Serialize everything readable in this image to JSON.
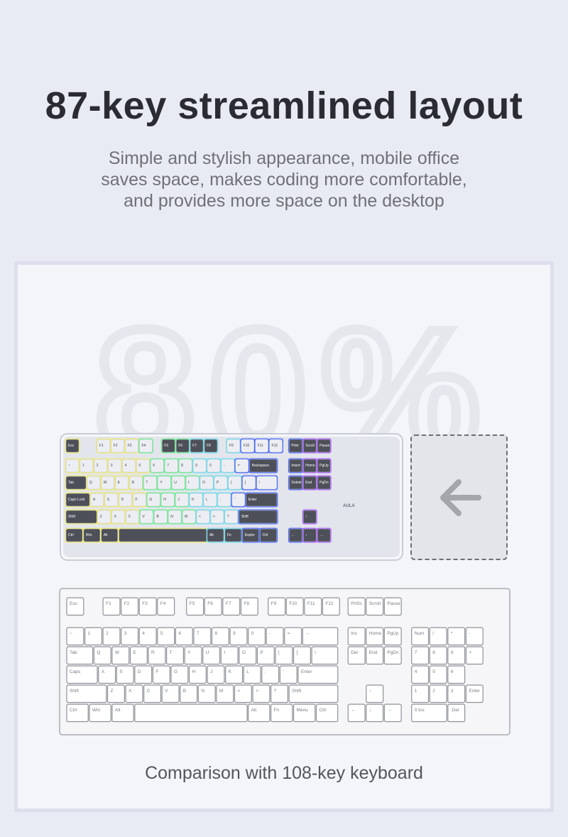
{
  "heading": {
    "title": "87-key streamlined layout",
    "subtitle_lines": [
      "Simple and stylish appearance, mobile office",
      "saves space, makes coding more comfortable,",
      "and provides more space on the desktop"
    ]
  },
  "panel": {
    "watermark": "80%",
    "caption": "Comparison with 108-key keyboard",
    "keyboard_87": {
      "brand": "AULA",
      "rows": [
        [
          "Esc",
          "F1",
          "F2",
          "F3",
          "F4",
          "F5",
          "F6",
          "F7",
          "F8",
          "F9",
          "F10",
          "F11",
          "F12",
          "Print",
          "Scroll",
          "Pause"
        ],
        [
          "~",
          "1",
          "2",
          "3",
          "4",
          "5",
          "6",
          "7",
          "8",
          "9",
          "0",
          "-",
          "=",
          "Backspace",
          "Insert",
          "Home",
          "PgUp"
        ],
        [
          "Tab",
          "Q",
          "W",
          "E",
          "R",
          "T",
          "Y",
          "U",
          "I",
          "O",
          "P",
          "[",
          "]",
          "\\",
          "Delete",
          "End",
          "PgDn"
        ],
        [
          "Caps Lock",
          "A",
          "S",
          "D",
          "F",
          "G",
          "H",
          "J",
          "K",
          "L",
          ";",
          "'",
          "Enter"
        ],
        [
          "Shift",
          "Z",
          "X",
          "C",
          "V",
          "B",
          "N",
          "M",
          "<",
          ">",
          "?",
          "Shift",
          "↑"
        ],
        [
          "Ctrl",
          "Win",
          "Alt",
          "",
          "Alt",
          "Fn",
          "Explor",
          "Ctrl",
          "←",
          "↓",
          "→"
        ]
      ]
    },
    "keyboard_108": {
      "rows": [
        [
          "Esc",
          "F1",
          "F2",
          "F3",
          "F4",
          "F5",
          "F6",
          "F7",
          "F8",
          "F9",
          "F10",
          "F11",
          "F12",
          "PrtSc",
          "Scroll",
          "Pause"
        ],
        [
          "~",
          "1",
          "2",
          "3",
          "4",
          "5",
          "6",
          "7",
          "8",
          "9",
          "0",
          "-",
          "=",
          "←",
          "Ins",
          "Home",
          "PgUp",
          "Num",
          "/",
          "*",
          "-"
        ],
        [
          "Tab",
          "Q",
          "W",
          "E",
          "R",
          "T",
          "Y",
          "U",
          "I",
          "O",
          "P",
          "[",
          "]",
          "\\",
          "Del",
          "End",
          "PgDn",
          "7",
          "8",
          "9",
          "+"
        ],
        [
          "Caps",
          "A",
          "S",
          "D",
          "F",
          "G",
          "H",
          "J",
          "K",
          "L",
          ";",
          "'",
          "Enter",
          "4",
          "5",
          "6"
        ],
        [
          "Shift",
          "Z",
          "X",
          "C",
          "V",
          "B",
          "N",
          "M",
          "<",
          ">",
          "?",
          "Shift",
          "↑",
          "1",
          "2",
          "3",
          "Enter"
        ],
        [
          "Ctrl",
          "Win",
          "Alt",
          "",
          "Alt",
          "Fn",
          "Menu",
          "Ctrl",
          "←",
          "↓",
          "→",
          "0 Ins",
          ".Del"
        ]
      ]
    }
  },
  "colors": {
    "background": "#e9ebf4",
    "title": "#2b2c33",
    "subtitle": "#707078",
    "panel": "#f4f5f9",
    "key_dark": "#4e5059",
    "key_light": "#eceef3",
    "glow_yellow": "#f2ec63",
    "glow_green": "#5ff28a",
    "glow_blue": "#3a5cff",
    "glow_magenta": "#e0218a"
  },
  "icons": {
    "arrow": "arrow-left-icon"
  }
}
